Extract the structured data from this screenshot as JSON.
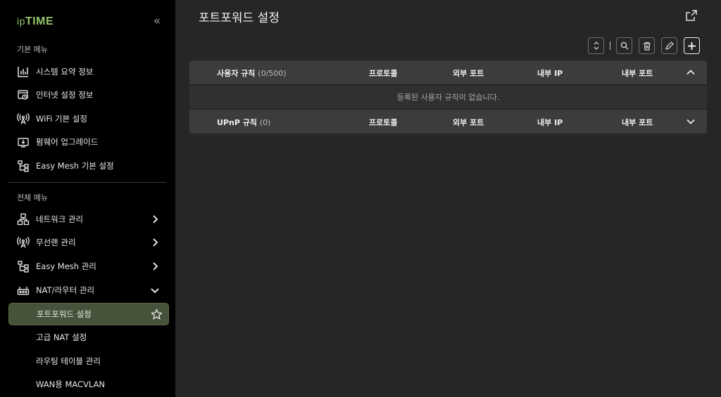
{
  "brand": {
    "logo_prefix": "ip",
    "logo_main": "TIME",
    "logo_color": "#93c46a"
  },
  "sidebar": {
    "collapse_glyph": "«",
    "basic_title": "기본 메뉴",
    "basic_items": [
      {
        "label": "시스템 요약 정보",
        "icon": "bar-chart-icon"
      },
      {
        "label": "인터넷 설정 정보",
        "icon": "internet-settings-icon"
      },
      {
        "label": "WiFi 기본 설정",
        "icon": "wifi-antenna-icon"
      },
      {
        "label": "펌웨어 업그레이드",
        "icon": "firmware-icon"
      },
      {
        "label": "Easy Mesh 기본 설정",
        "icon": "mesh-icon"
      }
    ],
    "all_title": "전체 메뉴",
    "all_items": [
      {
        "label": "네트워크 관리",
        "icon": "network-icon",
        "chevron": "right"
      },
      {
        "label": "무선랜 관리",
        "icon": "wifi-antenna-icon",
        "chevron": "right"
      },
      {
        "label": "Easy Mesh 관리",
        "icon": "mesh-icon",
        "chevron": "right"
      },
      {
        "label": "NAT/라우터 관리",
        "icon": "router-icon",
        "chevron": "down"
      }
    ],
    "sub_items": [
      {
        "label": "포트포워드 설정",
        "active": true
      },
      {
        "label": "고급 NAT 설정"
      },
      {
        "label": "라우팅 테이블 관리"
      },
      {
        "label": "WAN용 MACVLAN"
      }
    ],
    "active_color": "#46533a"
  },
  "main": {
    "title": "포트포워드 설정",
    "table": {
      "user_rules": {
        "label": "사용자 규칙",
        "count": "(0/500)",
        "columns": [
          "프로토콜",
          "외부 포트",
          "내부 IP",
          "내부 포트"
        ],
        "empty_message": "등록된 사용자 규칙이 없습니다."
      },
      "upnp_rules": {
        "label": "UPnP 규칙",
        "count": "(0)",
        "columns": [
          "프로토콜",
          "외부 포트",
          "내부 IP",
          "내부 포트"
        ]
      }
    }
  }
}
